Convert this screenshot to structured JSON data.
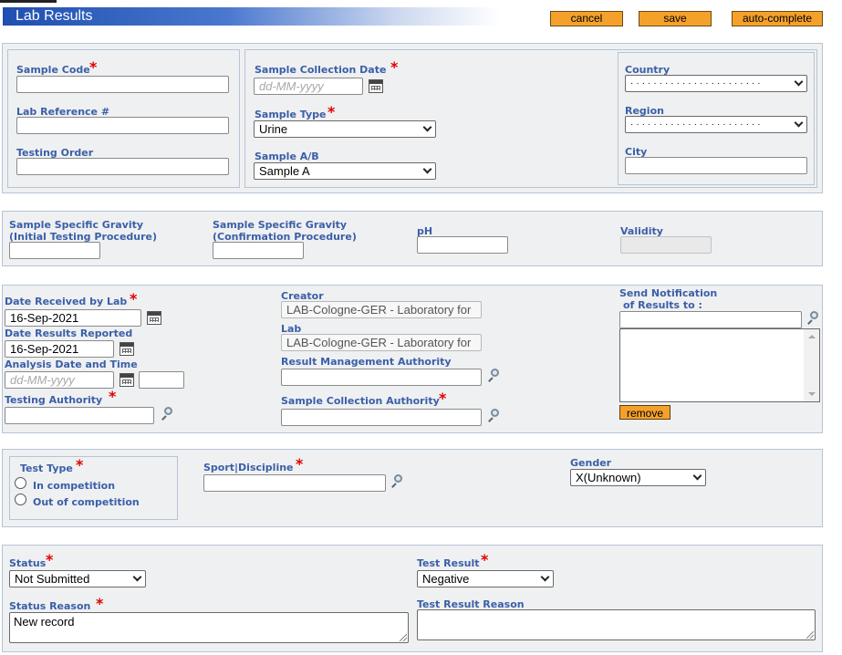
{
  "title": "Lab Results",
  "buttons": {
    "cancel": "cancel",
    "save": "save",
    "auto_complete": "auto-complete",
    "remove": "remove"
  },
  "sample": {
    "sample_code_label": "Sample Code",
    "lab_reference_label": "Lab Reference #",
    "testing_order_label": "Testing Order",
    "collection_date_label": "Sample Collection Date",
    "collection_date_placeholder": "dd-MM-yyyy",
    "sample_type_label": "Sample Type",
    "sample_type_value": "Urine",
    "sample_ab_label": "Sample A/B",
    "sample_ab_value": "Sample A",
    "country_label": "Country",
    "country_value": "·······················",
    "region_label": "Region",
    "region_value": "·······················",
    "city_label": "City"
  },
  "gravity": {
    "initial_label_1": "Sample Specific Gravity",
    "initial_label_2": "(Initial Testing Procedure)",
    "confirm_label_1": "Sample Specific Gravity",
    "confirm_label_2": "(Confirmation Procedure)",
    "ph_label": "pH",
    "validity_label": "Validity"
  },
  "reception": {
    "date_received_label": "Date Received by Lab",
    "date_received_value": "16-Sep-2021",
    "date_reported_label": "Date Results Reported",
    "date_reported_value": "16-Sep-2021",
    "analysis_label": "Analysis Date and Time",
    "analysis_placeholder": "dd-MM-yyyy",
    "testing_authority_label": "Testing Authority",
    "creator_label": "Creator",
    "creator_value": "LAB-Cologne-GER - Laboratory for",
    "lab_label": "Lab",
    "lab_value": "LAB-Cologne-GER - Laboratory for",
    "rma_label": "Result Management Authority",
    "sca_label": "Sample Collection Authority",
    "notify_label_1": "Send Notification",
    "notify_label_2": "of Results to :"
  },
  "test": {
    "test_type_label": "Test Type",
    "in_competition": "In competition",
    "out_of_competition": "Out of competition",
    "sport_label": "Sport|Discipline",
    "gender_label": "Gender",
    "gender_value": "X(Unknown)"
  },
  "status": {
    "status_label": "Status",
    "status_value": "Not Submitted",
    "status_reason_label": "Status Reason",
    "status_reason_value": "New record",
    "test_result_label": "Test Result",
    "test_result_value": "Negative",
    "test_result_reason_label": "Test Result Reason"
  }
}
